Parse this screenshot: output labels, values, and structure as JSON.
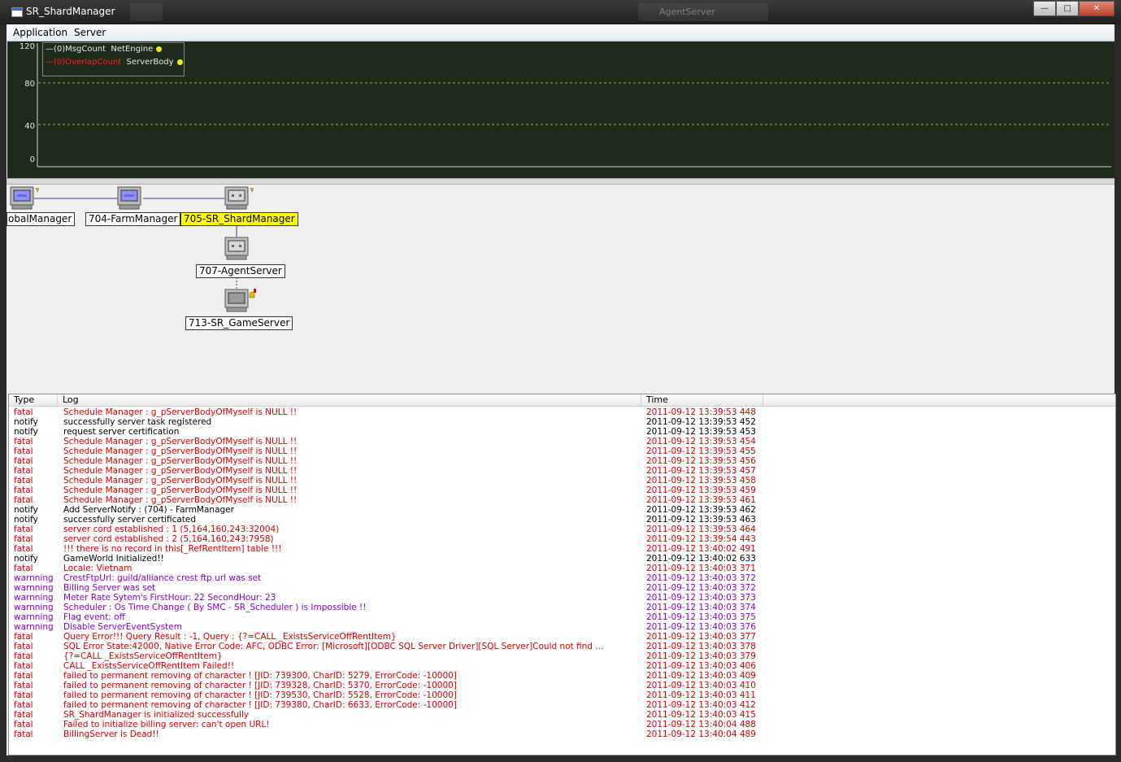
{
  "window": {
    "title": "SR_ShardManager",
    "background_tabs": [
      "",
      "AgentServer"
    ]
  },
  "menu": [
    "Application",
    "Server"
  ],
  "chart_data": {
    "type": "line",
    "ylim": [
      0,
      120
    ],
    "yticks": [
      "120",
      "80",
      "40",
      "0"
    ],
    "grid": "dashed horizontal at 40 and 80",
    "legend_position": "top-left",
    "series": [
      {
        "name": "(0)MsgCount",
        "source": "NetEngine",
        "color": "#e8e8e8",
        "values": []
      },
      {
        "name": "(0)OverlapCount",
        "source": "ServerBody",
        "color": "#ff2020",
        "values": []
      }
    ],
    "background": "#1e2b1b"
  },
  "nodes": [
    {
      "id": "global",
      "label": "obalManager",
      "state": "normal"
    },
    {
      "id": "farm",
      "label": "704-FarmManager",
      "state": "normal"
    },
    {
      "id": "shard",
      "label": "705-SR_ShardManager",
      "state": "selected"
    },
    {
      "id": "agent",
      "label": "707-AgentServer",
      "state": "normal"
    },
    {
      "id": "game",
      "label": "713-SR_GameServer",
      "state": "warning"
    }
  ],
  "log": {
    "columns": [
      "Type",
      "Log",
      "Time"
    ],
    "rows": [
      {
        "type": "fatal",
        "log": "Schedule Manager : g_pServerBodyOfMyself is NULL !!",
        "time": "2011-09-12 13:39:53 448"
      },
      {
        "type": "notify",
        "log": "successfully server task registered",
        "time": "2011-09-12 13:39:53 452"
      },
      {
        "type": "notify",
        "log": "request server certification",
        "time": "2011-09-12 13:39:53 453"
      },
      {
        "type": "fatal",
        "log": "Schedule Manager : g_pServerBodyOfMyself is NULL !!",
        "time": "2011-09-12 13:39:53 454"
      },
      {
        "type": "fatal",
        "log": "Schedule Manager : g_pServerBodyOfMyself is NULL !!",
        "time": "2011-09-12 13:39:53 455"
      },
      {
        "type": "fatal",
        "log": "Schedule Manager : g_pServerBodyOfMyself is NULL !!",
        "time": "2011-09-12 13:39:53 456"
      },
      {
        "type": "fatal",
        "log": "Schedule Manager : g_pServerBodyOfMyself is NULL !!",
        "time": "2011-09-12 13:39:53 457"
      },
      {
        "type": "fatal",
        "log": "Schedule Manager : g_pServerBodyOfMyself is NULL !!",
        "time": "2011-09-12 13:39:53 458"
      },
      {
        "type": "fatal",
        "log": "Schedule Manager : g_pServerBodyOfMyself is NULL !!",
        "time": "2011-09-12 13:39:53 459"
      },
      {
        "type": "fatal",
        "log": "Schedule Manager : g_pServerBodyOfMyself is NULL !!",
        "time": "2011-09-12 13:39:53 461"
      },
      {
        "type": "notify",
        "log": "Add ServerNotify : (704) - FarmManager",
        "time": "2011-09-12 13:39:53 462"
      },
      {
        "type": "notify",
        "log": "successfully server certificated",
        "time": "2011-09-12 13:39:53 463"
      },
      {
        "type": "fatal",
        "log": "server cord established : 1 (5,164,160,243:32004)",
        "time": "2011-09-12 13:39:53 464"
      },
      {
        "type": "fatal",
        "log": "server cord established : 2 (5,164,160,243:7958)",
        "time": "2011-09-12 13:39:54 443"
      },
      {
        "type": "fatal",
        "log": "!!! there is no record in this[_RefRentItem] table !!!",
        "time": "2011-09-12 13:40:02 491"
      },
      {
        "type": "notify",
        "log": "GameWorld Initialized!!",
        "time": "2011-09-12 13:40:02 633"
      },
      {
        "type": "fatal",
        "log": "Locale: Vietnam",
        "time": "2011-09-12 13:40:03 371"
      },
      {
        "type": "warnning",
        "log": "CrestFtpUrl: guild/alliance crest ftp url was set",
        "time": "2011-09-12 13:40:03 372"
      },
      {
        "type": "warnning",
        "log": "Billing Server was set",
        "time": "2011-09-12 13:40:03 372"
      },
      {
        "type": "warnning",
        "log": "Meter Rate Sytem's FirstHour: 22 SecondHour: 23",
        "time": "2011-09-12 13:40:03 373"
      },
      {
        "type": "warnning",
        "log": "Scheduler : Os Time Change ( By SMC - SR_Scheduler ) is Impossible !!",
        "time": "2011-09-12 13:40:03 374"
      },
      {
        "type": "warnning",
        "log": "Flag event: off",
        "time": "2011-09-12 13:40:03 375"
      },
      {
        "type": "warnning",
        "log": "Disable ServerEventSystem",
        "time": "2011-09-12 13:40:03 376"
      },
      {
        "type": "fatal",
        "log": "Query Error!!! Query Result : -1, Query : {?=CALL _ExistsServiceOffRentItem}",
        "time": "2011-09-12 13:40:03 377"
      },
      {
        "type": "fatal",
        "log": "SQL Error State:42000, Native Error Code: AFC, ODBC Error: [Microsoft][ODBC SQL Server Driver][SQL Server]Could not find ...",
        "time": "2011-09-12 13:40:03 378"
      },
      {
        "type": "fatal",
        "log": "{?=CALL _ExistsServiceOffRentItem}",
        "time": "2011-09-12 13:40:03 379"
      },
      {
        "type": "fatal",
        "log": "CALL _ExistsServiceOffRentItem Failed!!",
        "time": "2011-09-12 13:40:03 406"
      },
      {
        "type": "fatal",
        "log": "failed to permanent removing of character ! [JID: 739300, CharID: 5279, ErrorCode: -10000]",
        "time": "2011-09-12 13:40:03 409"
      },
      {
        "type": "fatal",
        "log": "failed to permanent removing of character ! [JID: 739328, CharID: 5370, ErrorCode: -10000]",
        "time": "2011-09-12 13:40:03 410"
      },
      {
        "type": "fatal",
        "log": "failed to permanent removing of character ! [JID: 739530, CharID: 5528, ErrorCode: -10000]",
        "time": "2011-09-12 13:40:03 411"
      },
      {
        "type": "fatal",
        "log": "failed to permanent removing of character ! [JID: 739380, CharID: 6633, ErrorCode: -10000]",
        "time": "2011-09-12 13:40:03 412"
      },
      {
        "type": "fatal",
        "log": "SR_ShardManager is initialized successfully",
        "time": "2011-09-12 13:40:03 415"
      },
      {
        "type": "fatal",
        "log": "Failed to initialize billing server: can't open URL!",
        "time": "2011-09-12 13:40:04 488"
      },
      {
        "type": "fatal",
        "log": "BillingServer is Dead!!",
        "time": "2011-09-12 13:40:04 489"
      }
    ]
  },
  "colors": {
    "fatal": "#d10000",
    "notify": "#000000",
    "warnning": "#8a00c8",
    "selected_node": "#ffff00"
  }
}
